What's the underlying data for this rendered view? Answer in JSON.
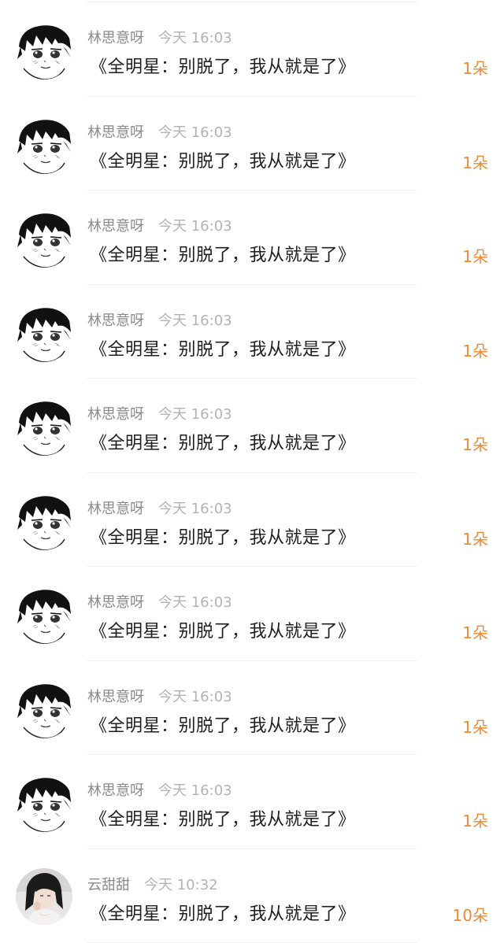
{
  "comments": [
    {
      "avatar": "anime-boy-avatar",
      "name": "林思意呀",
      "time": "今天 16:03",
      "message": "《全明星：别脱了，我从就是了》",
      "reward": "1朵"
    },
    {
      "avatar": "anime-boy-avatar",
      "name": "林思意呀",
      "time": "今天 16:03",
      "message": "《全明星：别脱了，我从就是了》",
      "reward": "1朵"
    },
    {
      "avatar": "anime-boy-avatar",
      "name": "林思意呀",
      "time": "今天 16:03",
      "message": "《全明星：别脱了，我从就是了》",
      "reward": "1朵"
    },
    {
      "avatar": "anime-boy-avatar",
      "name": "林思意呀",
      "time": "今天 16:03",
      "message": "《全明星：别脱了，我从就是了》",
      "reward": "1朵"
    },
    {
      "avatar": "anime-boy-avatar",
      "name": "林思意呀",
      "time": "今天 16:03",
      "message": "《全明星：别脱了，我从就是了》",
      "reward": "1朵"
    },
    {
      "avatar": "anime-boy-avatar",
      "name": "林思意呀",
      "time": "今天 16:03",
      "message": "《全明星：别脱了，我从就是了》",
      "reward": "1朵"
    },
    {
      "avatar": "anime-boy-avatar",
      "name": "林思意呀",
      "time": "今天 16:03",
      "message": "《全明星：别脱了，我从就是了》",
      "reward": "1朵"
    },
    {
      "avatar": "anime-boy-avatar",
      "name": "林思意呀",
      "time": "今天 16:03",
      "message": "《全明星：别脱了，我从就是了》",
      "reward": "1朵"
    },
    {
      "avatar": "anime-boy-avatar",
      "name": "林思意呀",
      "time": "今天 16:03",
      "message": "《全明星：别脱了，我从就是了》",
      "reward": "1朵"
    },
    {
      "avatar": "photo-girl-avatar",
      "name": "云甜甜",
      "time": "今天 10:32",
      "message": "《全明星：别脱了，我从就是了》",
      "reward": "10朵"
    }
  ],
  "colors": {
    "name": "#8a8a8a",
    "time": "#b3b3b3",
    "message": "#1e1e1e",
    "reward": "#f08a2e"
  }
}
